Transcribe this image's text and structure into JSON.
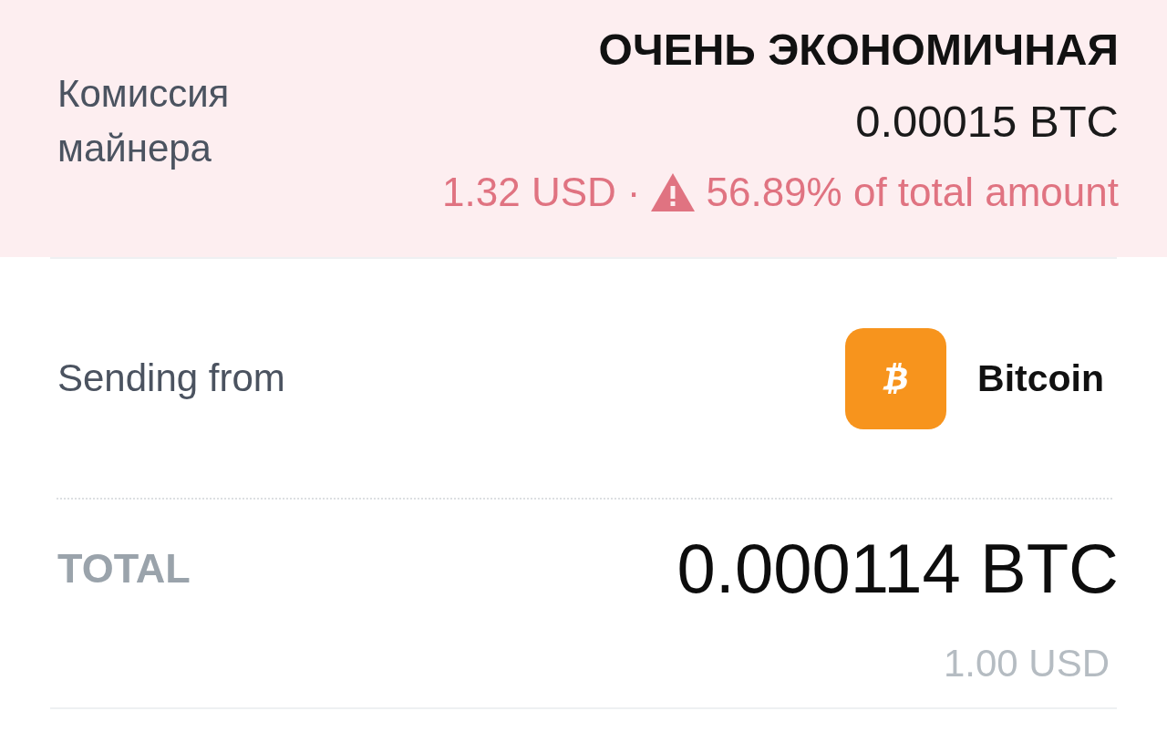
{
  "miner_fee": {
    "label": "Комиссия майнера",
    "speed": "ОЧЕНЬ ЭКОНОМИЧНАЯ",
    "amount": "0.00015 BTC",
    "fiat": "1.32 USD",
    "separator": "·",
    "warning": true,
    "warning_text": "56.89% of total amount"
  },
  "sending_from": {
    "label": "Sending from",
    "wallet": "Bitcoin"
  },
  "total": {
    "label": "TOTAL",
    "amount": "0.000114 BTC",
    "fiat": "1.00 USD"
  }
}
